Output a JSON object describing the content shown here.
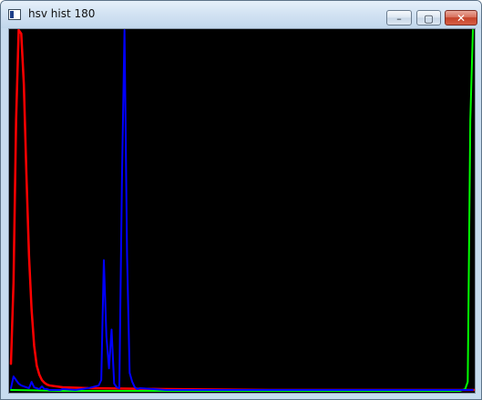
{
  "window": {
    "title": "hsv hist 180",
    "controls": {
      "minimize_label": "–",
      "maximize_label": "▢",
      "close_label": "✕"
    }
  },
  "colors": {
    "background": "#000000",
    "hue_curve": "#ff0000",
    "saturation_curve": "#00ff00",
    "value_curve": "#0000ff"
  },
  "chart_data": {
    "type": "line",
    "x_bins": 180,
    "y_max": 400,
    "series": [
      {
        "color": "#ff0000",
        "x": [
          0,
          1,
          2,
          3,
          4,
          5,
          6,
          7,
          8,
          9,
          10,
          11,
          12,
          13,
          14,
          15,
          20,
          30,
          60,
          100,
          140,
          180
        ],
        "values": [
          30,
          120,
          300,
          400,
          396,
          340,
          240,
          150,
          90,
          50,
          28,
          18,
          12,
          9,
          7,
          6,
          4,
          3,
          2,
          1,
          1,
          1
        ]
      },
      {
        "color": "#00ff00",
        "x": [
          0,
          20,
          60,
          100,
          140,
          174,
          176,
          177,
          178,
          179
        ],
        "values": [
          1,
          0,
          0,
          0,
          0,
          0,
          2,
          10,
          300,
          400
        ]
      },
      {
        "color": "#0000ff",
        "x": [
          0,
          1,
          2,
          3,
          4,
          5,
          6,
          7,
          8,
          9,
          10,
          11,
          12,
          13,
          14,
          15,
          16,
          17,
          18,
          19,
          20,
          25,
          30,
          34,
          35,
          36,
          37,
          38,
          39,
          40,
          41,
          42,
          43,
          44,
          45,
          46,
          47,
          48,
          49,
          50,
          55,
          60,
          80,
          100,
          120,
          140,
          160,
          175,
          179
        ],
        "values": [
          3,
          16,
          12,
          8,
          6,
          5,
          4,
          3,
          10,
          4,
          3,
          2,
          5,
          2,
          2,
          1,
          1,
          1,
          1,
          1,
          2,
          1,
          3,
          6,
          12,
          145,
          60,
          25,
          68,
          8,
          4,
          3,
          230,
          400,
          150,
          20,
          10,
          4,
          2,
          3,
          2,
          1,
          1,
          1,
          1,
          1,
          1,
          1,
          1
        ]
      }
    ]
  }
}
